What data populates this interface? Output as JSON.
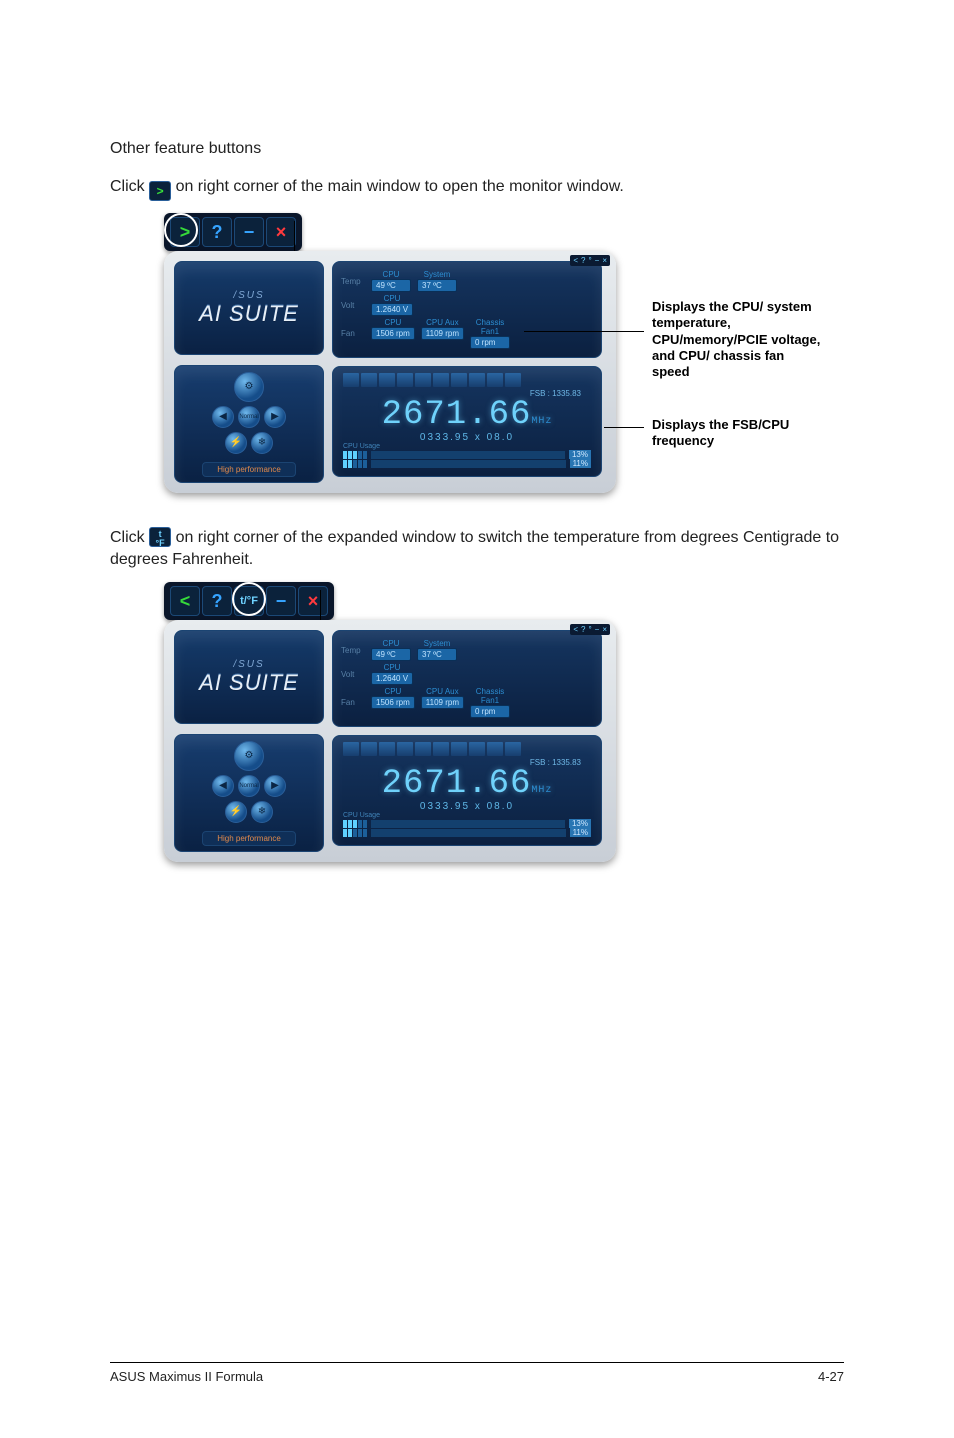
{
  "heading": "Other feature buttons",
  "intro1_a": "Click ",
  "intro1_b": " on right corner of the main window to open the monitor window.",
  "intro2_a": "Click ",
  "intro2_b": " on right corner of the expanded window to switch the temperature from degrees Centigrade to degrees Fahrenheit.",
  "callout1": "Displays the CPU/ system temperature, CPU/memory/PCIE voltage, and CPU/ chassis fan speed",
  "callout2": "Displays the FSB/CPU frequency",
  "ui": {
    "logo_brand": "/SUS",
    "logo_product": "AI SUITE",
    "perf_label": "High performance",
    "temp": {
      "lbl": "Temp",
      "cpu_lbl": "CPU",
      "cpu": "49 ºC",
      "sys_lbl": "System",
      "sys": "37 ºC"
    },
    "volt": {
      "lbl": "Volt",
      "cpu_lbl": "CPU",
      "cpu": "1.2640 V"
    },
    "fan": {
      "lbl": "Fan",
      "cpu_lbl": "CPU",
      "cpu": "1506 rpm",
      "aux_lbl": "CPU Aux",
      "aux": "1109 rpm",
      "cha_lbl": "Chassis Fan1",
      "cha": "0 rpm"
    },
    "fsb_line": "FSB : 1335.83",
    "freq": "2671.66",
    "freq_unit": "MHz",
    "subfreq": "0333.95  x  08.0",
    "usage_lbl": "CPU Usage",
    "use1": "13%",
    "use2": "11%"
  },
  "zoom1": {
    "b1": ">",
    "b2": "?",
    "b3": "−",
    "b4": "×"
  },
  "zoom2": {
    "b1": "<",
    "b2": "?",
    "b3": "t/°F",
    "b4": "−",
    "b5": "×"
  },
  "mini": {
    "a": "<",
    "b": "?",
    "c": "°",
    "d": "−",
    "e": "×"
  },
  "footer": {
    "left": "ASUS Maximus II Formula",
    "right": "4-27"
  }
}
